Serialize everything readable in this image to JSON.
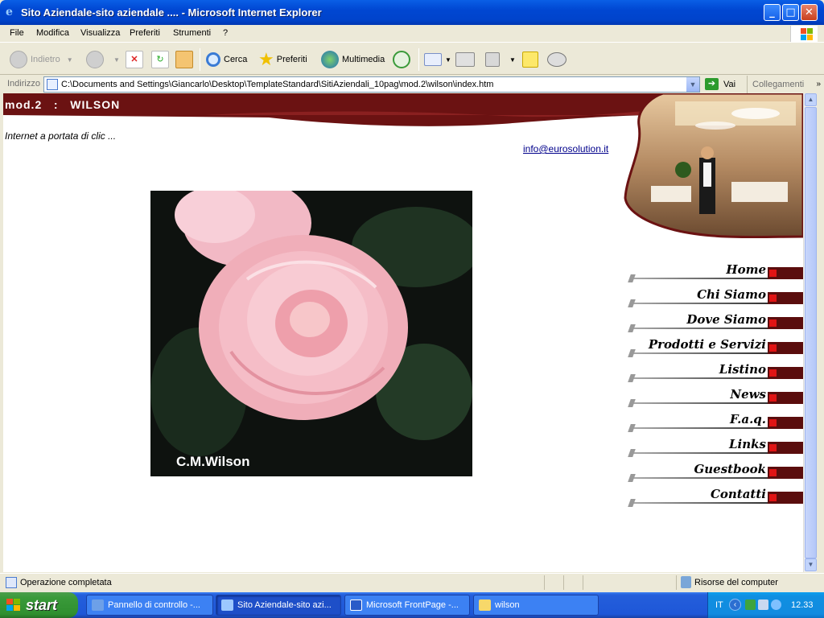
{
  "window": {
    "title": "Sito Aziendale-sito aziendale .... - Microsoft Internet Explorer"
  },
  "menu": [
    "File",
    "Modifica",
    "Visualizza",
    "Preferiti",
    "Strumenti",
    "?"
  ],
  "toolbar": {
    "back": "Indietro",
    "search": "Cerca",
    "favorites": "Preferiti",
    "media": "Multimedia"
  },
  "address": {
    "label": "Indirizzo",
    "value": "C:\\Documents and Settings\\Giancarlo\\Desktop\\TemplateStandard\\SitiAziendali_10pag\\mod.2\\wilson\\index.htm",
    "go": "Vai",
    "links": "Collegamenti"
  },
  "page": {
    "site_title": "mod.2   :   WILSON",
    "slogan": "Internet a portata di clic ...",
    "email": "info@eurosolution.it",
    "hero_caption": "C.M.Wilson",
    "nav": [
      "Home",
      "Chi Siamo",
      "Dove Siamo",
      "Prodotti e Servizi",
      "Listino",
      "News",
      "F.a.q.",
      "Links",
      "Guestbook",
      "Contatti"
    ]
  },
  "status": {
    "text": "Operazione completata",
    "zone": "Risorse del computer"
  },
  "taskbar": {
    "start": "start",
    "tasks": [
      "Pannello di controllo -...",
      "Sito Aziendale-sito azi...",
      "Microsoft FrontPage -...",
      "wilson"
    ],
    "lang": "IT",
    "clock": "12.33"
  },
  "colors": {
    "brand_maroon": "#6b1212",
    "nav_marker": "#e01414",
    "xp_blue": "#0047D2"
  }
}
